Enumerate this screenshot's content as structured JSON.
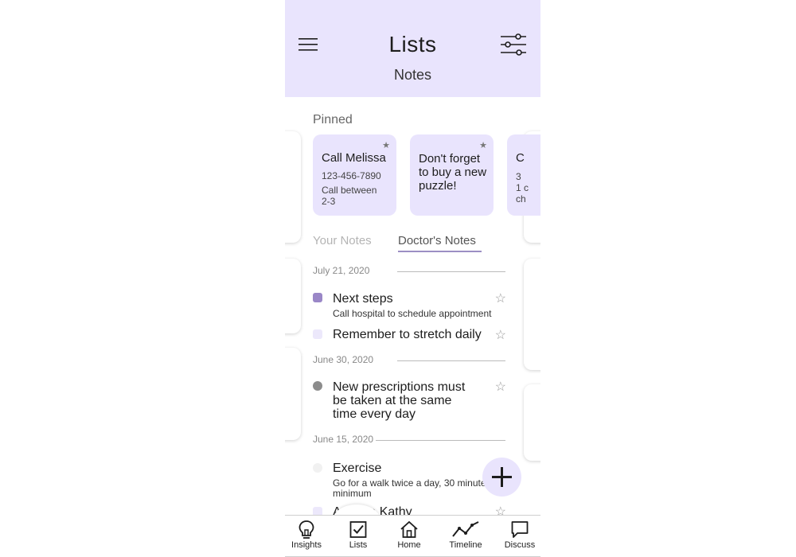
{
  "header": {
    "title": "Lists",
    "subtitle": "Notes",
    "background": "#e9e4fd"
  },
  "pinned": {
    "label": "Pinned",
    "cards": [
      {
        "title": "Call Melissa",
        "lines": [
          "123-456-7890",
          "Call between",
          "2-3"
        ],
        "star": "★"
      },
      {
        "title": "Don't forget to buy a new puzzle!",
        "lines": [],
        "star": "★"
      },
      {
        "title": "C",
        "lines": [
          "3",
          "1 c",
          "ch"
        ],
        "star": ""
      }
    ]
  },
  "tabs": {
    "your_notes": "Your Notes",
    "doctors_notes": "Doctor's Notes",
    "active": "doctors_notes"
  },
  "groups": [
    {
      "date": "July 21, 2020",
      "notes": [
        {
          "title": "Next steps",
          "subtitle": "Call hospital to schedule appointment",
          "dot_color": "#9a87c7",
          "star": "☆"
        },
        {
          "title": "Remember to stretch daily",
          "subtitle": "",
          "dot_color": "#ece8fb",
          "star": "☆"
        }
      ]
    },
    {
      "date": "June 30, 2020",
      "notes": [
        {
          "title": "New prescriptions must be taken at the same time every day",
          "subtitle": "",
          "dot_color": "#8c8c8c",
          "star": "☆"
        }
      ]
    },
    {
      "date": "June 15, 2020",
      "notes": [
        {
          "title": "Exercise",
          "subtitle": "Go for a walk twice a day, 30 minutes minimum",
          "dot_color": "#f1f1f1",
          "star": ""
        },
        {
          "title": "A nurse Kathy",
          "subtitle": "",
          "dot_color": "#ece8fb",
          "star": "☆"
        }
      ]
    }
  ],
  "fab": {
    "icon": "plus-icon"
  },
  "nav": [
    {
      "label": "Insights",
      "icon": "lightbulb-icon"
    },
    {
      "label": "Lists",
      "icon": "checkbox-icon"
    },
    {
      "label": "Home",
      "icon": "home-icon"
    },
    {
      "label": "Timeline",
      "icon": "trend-line-icon"
    },
    {
      "label": "Discuss",
      "icon": "chat-bubble-icon"
    }
  ]
}
